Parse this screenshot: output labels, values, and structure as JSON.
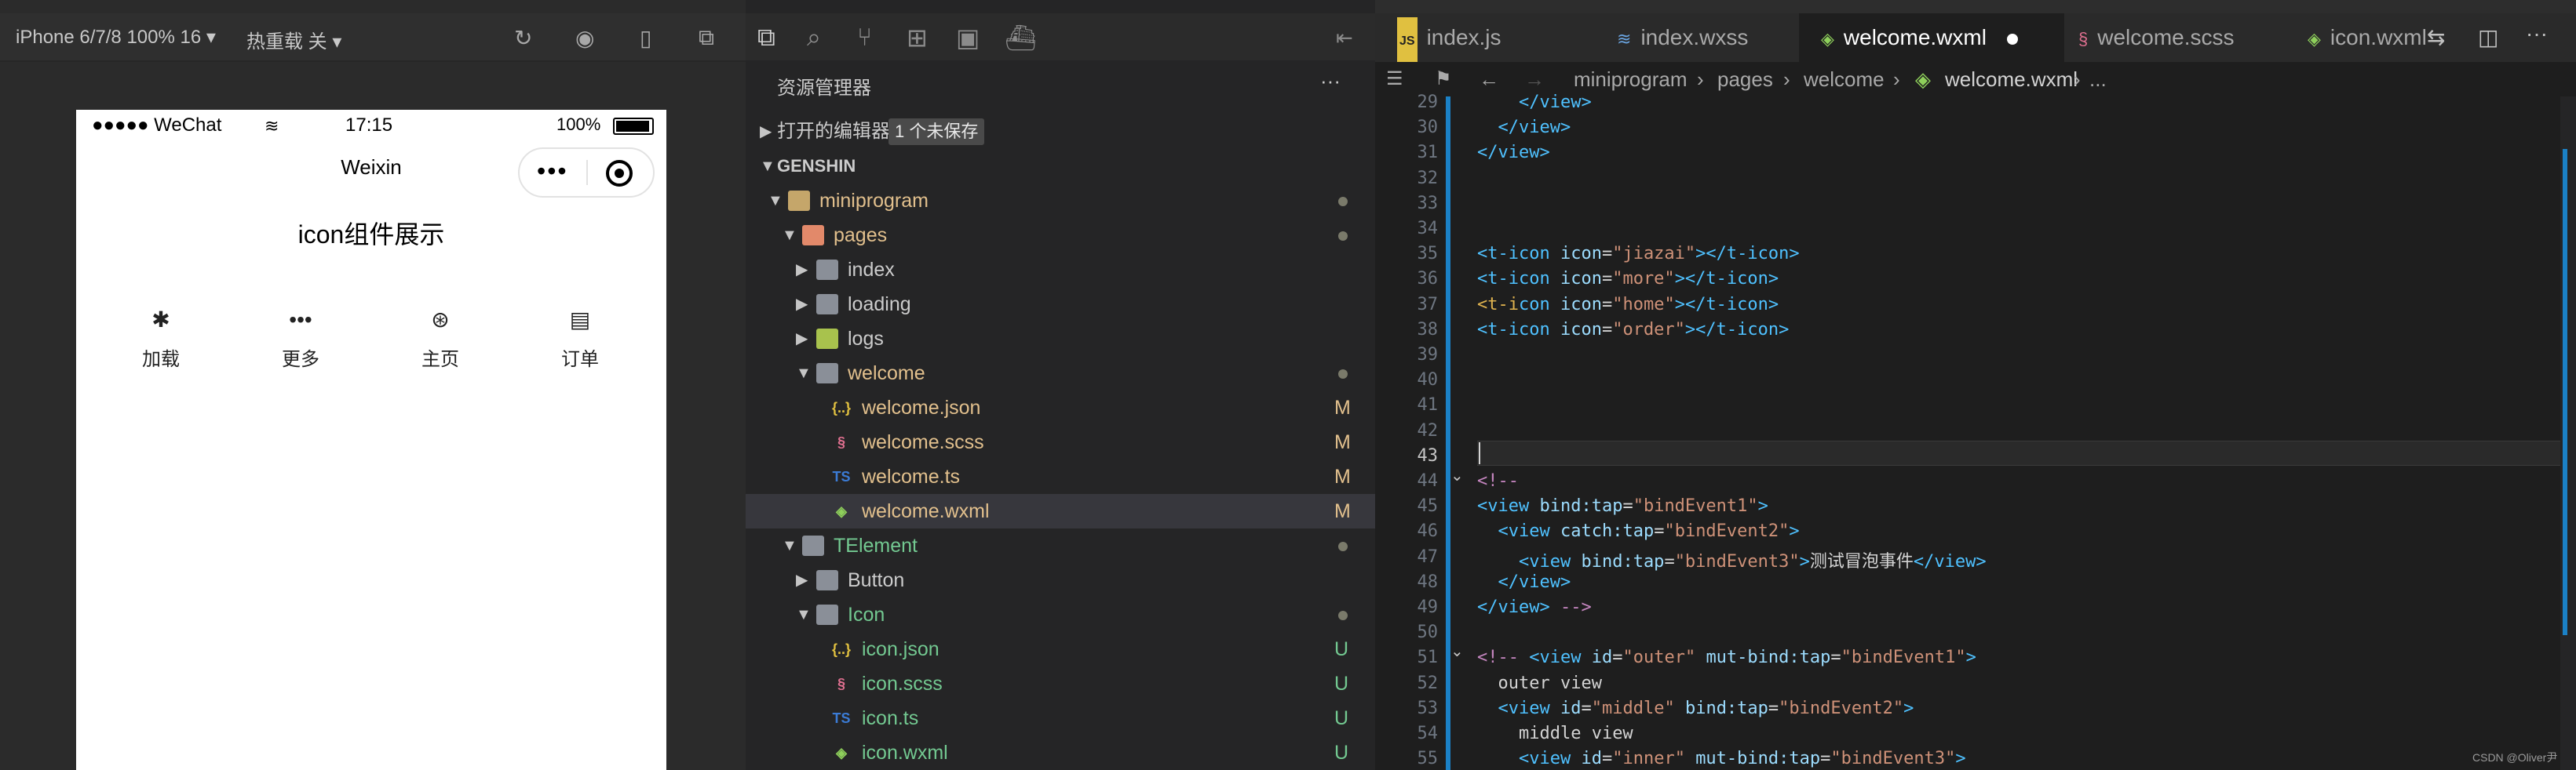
{
  "top_bar": "",
  "simulator": {
    "device_label": "iPhone 6/7/8 100% 16 ▾",
    "hot_reload_label": "热重载 关 ▾",
    "status": {
      "signal": "●●●●● WeChat",
      "time": "17:15",
      "battery": "100%"
    },
    "nav_title": "Weixin",
    "page_title": "icon组件展示",
    "icons": [
      {
        "name": "loading-icon",
        "glyph": "✱",
        "label": "加载"
      },
      {
        "name": "more-icon",
        "glyph": "•••",
        "label": "更多"
      },
      {
        "name": "home-icon",
        "glyph": "⊛",
        "label": "主页"
      },
      {
        "name": "order-icon",
        "glyph": "▤",
        "label": "订单"
      }
    ]
  },
  "explorer": {
    "title": "资源管理器",
    "more": "···",
    "open_editors": "打开的编辑器",
    "unsaved_badge": "1 个未保存",
    "project": "GENSHIN",
    "tree": [
      {
        "name": "miniprogram",
        "type": "folder",
        "open": true,
        "depth": 1,
        "dot": true
      },
      {
        "name": "pages",
        "type": "folder",
        "open": true,
        "depth": 2,
        "dot": true
      },
      {
        "name": "index",
        "type": "folder",
        "open": false,
        "depth": 3
      },
      {
        "name": "loading",
        "type": "folder",
        "open": false,
        "depth": 3
      },
      {
        "name": "logs",
        "type": "folder",
        "open": false,
        "depth": 3
      },
      {
        "name": "welcome",
        "type": "folder",
        "open": true,
        "depth": 3,
        "dot": true
      },
      {
        "name": "welcome.json",
        "type": "json",
        "depth": 4,
        "status": "M"
      },
      {
        "name": "welcome.scss",
        "type": "scss",
        "depth": 4,
        "status": "M"
      },
      {
        "name": "welcome.ts",
        "type": "ts",
        "depth": 4,
        "status": "M"
      },
      {
        "name": "welcome.wxml",
        "type": "wxml",
        "depth": 4,
        "status": "M",
        "selected": true
      },
      {
        "name": "TElement",
        "type": "folder",
        "open": true,
        "depth": 2,
        "dot": true
      },
      {
        "name": "Button",
        "type": "folder",
        "open": false,
        "depth": 3
      },
      {
        "name": "Icon",
        "type": "folder",
        "open": true,
        "depth": 3,
        "dot": true
      },
      {
        "name": "icon.json",
        "type": "json",
        "depth": 4,
        "status": "U"
      },
      {
        "name": "icon.scss",
        "type": "scss",
        "depth": 4,
        "status": "U"
      },
      {
        "name": "icon.ts",
        "type": "ts",
        "depth": 4,
        "status": "U"
      },
      {
        "name": "icon.wxml",
        "type": "wxml",
        "depth": 4,
        "status": "U"
      }
    ]
  },
  "editor": {
    "tabs": [
      {
        "label": "index.js",
        "icon": "JS",
        "active": false
      },
      {
        "label": "index.wxss",
        "icon": "≋",
        "active": false
      },
      {
        "label": "welcome.wxml",
        "icon": "◈",
        "active": true,
        "modified": true
      },
      {
        "label": "welcome.scss",
        "icon": "§",
        "active": false
      },
      {
        "label": "icon.wxml",
        "icon": "◈",
        "active": false
      }
    ],
    "breadcrumb": [
      "miniprogram",
      "pages",
      "welcome",
      "welcome.wxml",
      "..."
    ],
    "lines": [
      {
        "n": "29",
        "html": "    <span class='tag'>&lt;/view&gt;</span>"
      },
      {
        "n": "30",
        "html": "  <span class='tag'>&lt;/view&gt;</span>"
      },
      {
        "n": "31",
        "html": "<span class='tag'>&lt;/view&gt;</span>"
      },
      {
        "n": "32",
        "html": ""
      },
      {
        "n": "33",
        "html": ""
      },
      {
        "n": "34",
        "html": ""
      },
      {
        "n": "35",
        "html": "<span class='tag'>&lt;t-icon</span> <span class='attr'>icon</span>=<span class='str'>\"jiazai\"</span><span class='tag'>&gt;&lt;/t-icon&gt;</span>"
      },
      {
        "n": "36",
        "html": "<span class='tag'>&lt;t-icon</span> <span class='attr'>icon</span>=<span class='str'>\"more\"</span><span class='tag'>&gt;&lt;/t-icon&gt;</span>"
      },
      {
        "n": "37",
        "html": "<span class='hl-tag'>&lt;t-i</span><span class='tag'>con</span> <span class='attr'>icon</span>=<span class='str'>\"home\"</span><span class='tag'>&gt;&lt;/t-icon&gt;</span>"
      },
      {
        "n": "38",
        "html": "<span class='tag'>&lt;t-icon</span> <span class='attr'>icon</span>=<span class='str'>\"order\"</span><span class='tag'>&gt;&lt;/t-icon&gt;</span>"
      },
      {
        "n": "39",
        "html": ""
      },
      {
        "n": "40",
        "html": ""
      },
      {
        "n": "41",
        "html": ""
      },
      {
        "n": "42",
        "html": ""
      },
      {
        "n": "43",
        "html": ""
      },
      {
        "n": "44",
        "html": "<span class='cmt'>&lt;!--</span>"
      },
      {
        "n": "45",
        "html": "<span class='tag'>&lt;view</span> <span class='attr'>bind:tap</span>=<span class='str'>\"bindEvent1\"</span><span class='tag'>&gt;</span>"
      },
      {
        "n": "46",
        "html": "  <span class='tag'>&lt;view</span> <span class='attr'>catch:tap</span>=<span class='str'>\"bindEvent2\"</span><span class='tag'>&gt;</span>"
      },
      {
        "n": "47",
        "html": "    <span class='tag'>&lt;view</span> <span class='attr'>bind:tap</span>=<span class='str'>\"bindEvent3\"</span><span class='tag'>&gt;</span>测试冒泡事件<span class='tag'>&lt;/view&gt;</span>"
      },
      {
        "n": "48",
        "html": "  <span class='tag'>&lt;/view&gt;</span>"
      },
      {
        "n": "49",
        "html": "<span class='tag'>&lt;/view&gt;</span> <span class='cmt'>--&gt;</span>"
      },
      {
        "n": "50",
        "html": ""
      },
      {
        "n": "51",
        "html": "<span class='cmt'>&lt;!--</span> <span class='tag'>&lt;view</span> <span class='attr'>id</span>=<span class='str'>\"outer\"</span> <span class='attr'>mut-bind:tap</span>=<span class='str'>\"bindEvent1\"</span><span class='tag'>&gt;</span>"
      },
      {
        "n": "52",
        "html": "  <span class='txt'>outer view</span>"
      },
      {
        "n": "53",
        "html": "  <span class='tag'>&lt;view</span> <span class='attr'>id</span>=<span class='str'>\"middle\"</span> <span class='attr'>bind:tap</span>=<span class='str'>\"bindEvent2\"</span><span class='tag'>&gt;</span>"
      },
      {
        "n": "54",
        "html": "    <span class='txt'>middle view</span>"
      },
      {
        "n": "55",
        "html": "    <span class='tag'>&lt;view</span> <span class='attr'>id</span>=<span class='str'>\"inner\"</span> <span class='attr'>mut-bind:tap</span>=<span class='str'>\"bindEvent3\"</span><span class='tag'>&gt;</span>"
      }
    ],
    "watermark": "CSDN @Oliver尹"
  },
  "colors": {
    "accent": "#e0b34f",
    "folder": "#c5a66a"
  }
}
